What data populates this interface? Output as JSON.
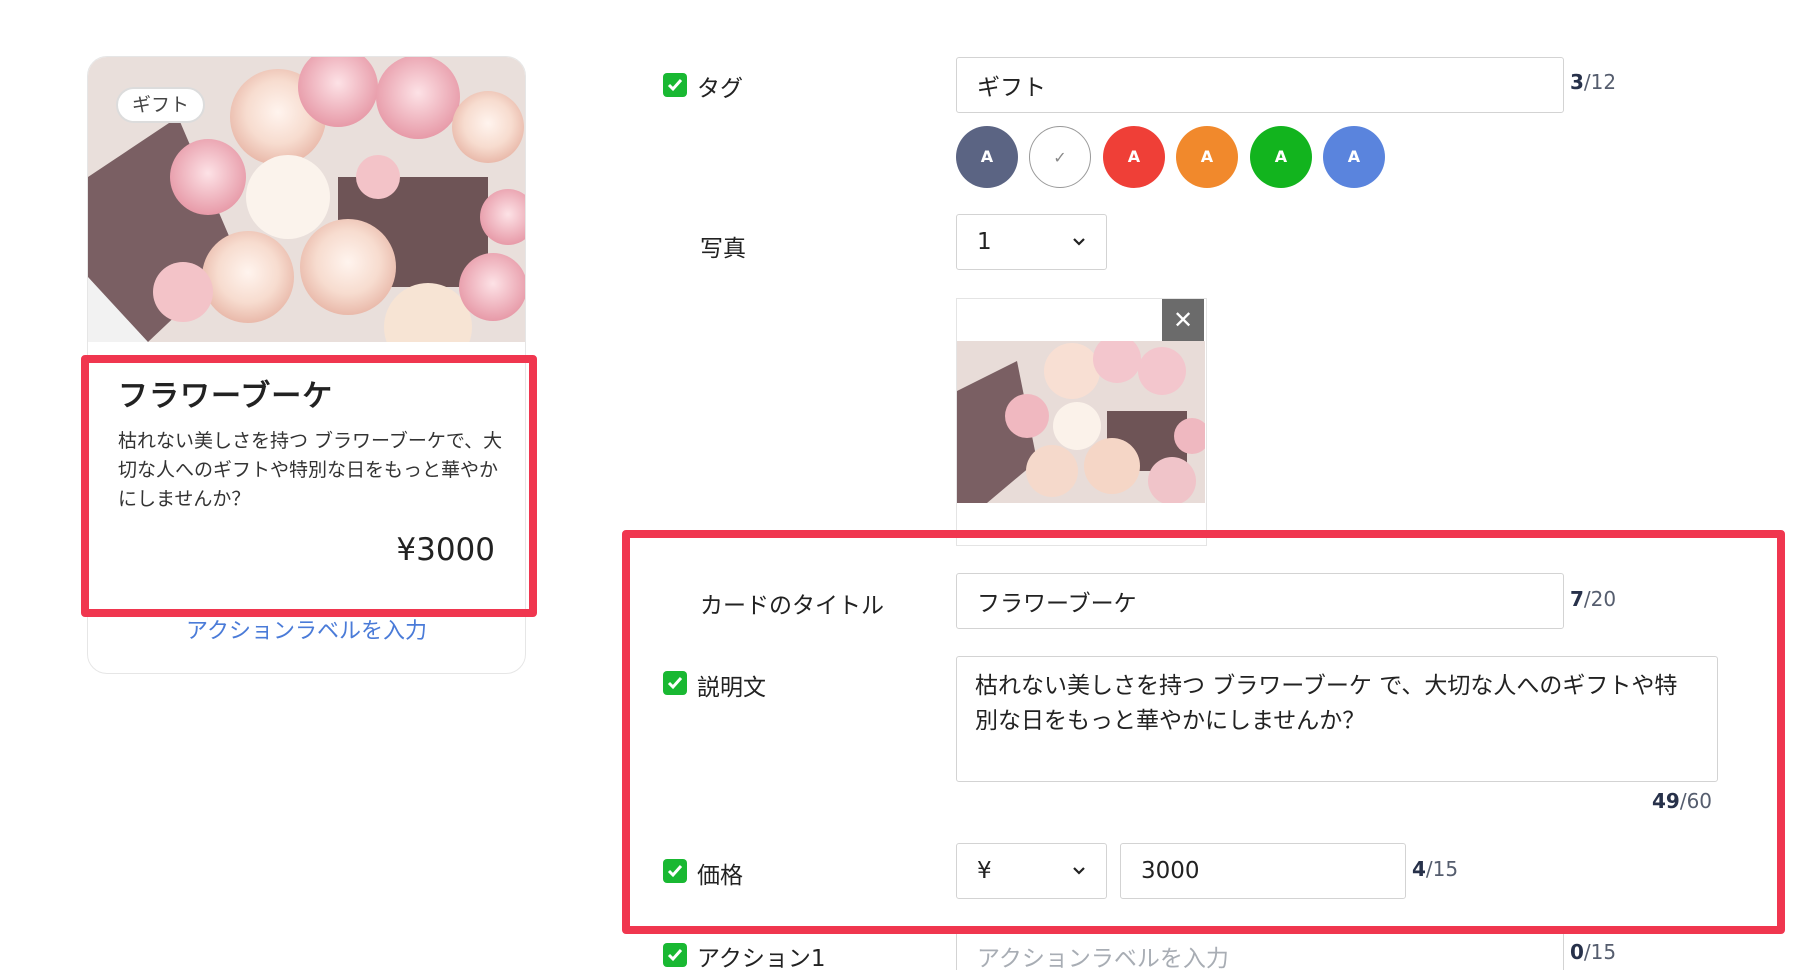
{
  "preview": {
    "tag": "ギフト",
    "title": "フラワーブーケ",
    "description": "枯れない美しさを持つ ブラワーブーケで、大切な人へのギフトや特別な日をもっと華やかにしませんか？",
    "price": "¥3000",
    "action_label": "アクションラベルを入力"
  },
  "form": {
    "tag": {
      "label": "タグ",
      "checked": true,
      "value": "ギフト",
      "counter_used": "3",
      "counter_max": "/12"
    },
    "tag_colors": [
      {
        "name": "navy",
        "color": "#5b6483",
        "glyph": "A"
      },
      {
        "name": "white",
        "color": "#ffffff",
        "glyph": "✓",
        "selected": true
      },
      {
        "name": "red",
        "color": "#ef3f37",
        "glyph": "A"
      },
      {
        "name": "orange",
        "color": "#f1892c",
        "glyph": "A"
      },
      {
        "name": "green",
        "color": "#12b41e",
        "glyph": "A"
      },
      {
        "name": "blue",
        "color": "#5a84dd",
        "glyph": "A"
      }
    ],
    "photo": {
      "label": "写真",
      "count": "1",
      "remove_glyph": "✕"
    },
    "card_title": {
      "label": "カードのタイトル",
      "value": "フラワーブーケ",
      "counter_used": "7",
      "counter_max": "/20"
    },
    "description": {
      "label": "説明文",
      "checked": true,
      "value": "枯れない美しさを持つ ブラワーブーケ で、大切な人へのギフトや特別な日をもっと華やかにしませんか？",
      "counter_used": "49",
      "counter_max": "/60"
    },
    "price": {
      "label": "価格",
      "checked": true,
      "currency": "¥",
      "value": "3000",
      "counter_used": "4",
      "counter_max": "/15"
    },
    "action1": {
      "label": "アクション1",
      "checked": true,
      "placeholder": "アクションラベルを入力",
      "counter_used": "0",
      "counter_max": "/15"
    }
  },
  "colors": {
    "highlight": "#f0364f",
    "check": "#19b832",
    "link": "#4a7bd8"
  }
}
